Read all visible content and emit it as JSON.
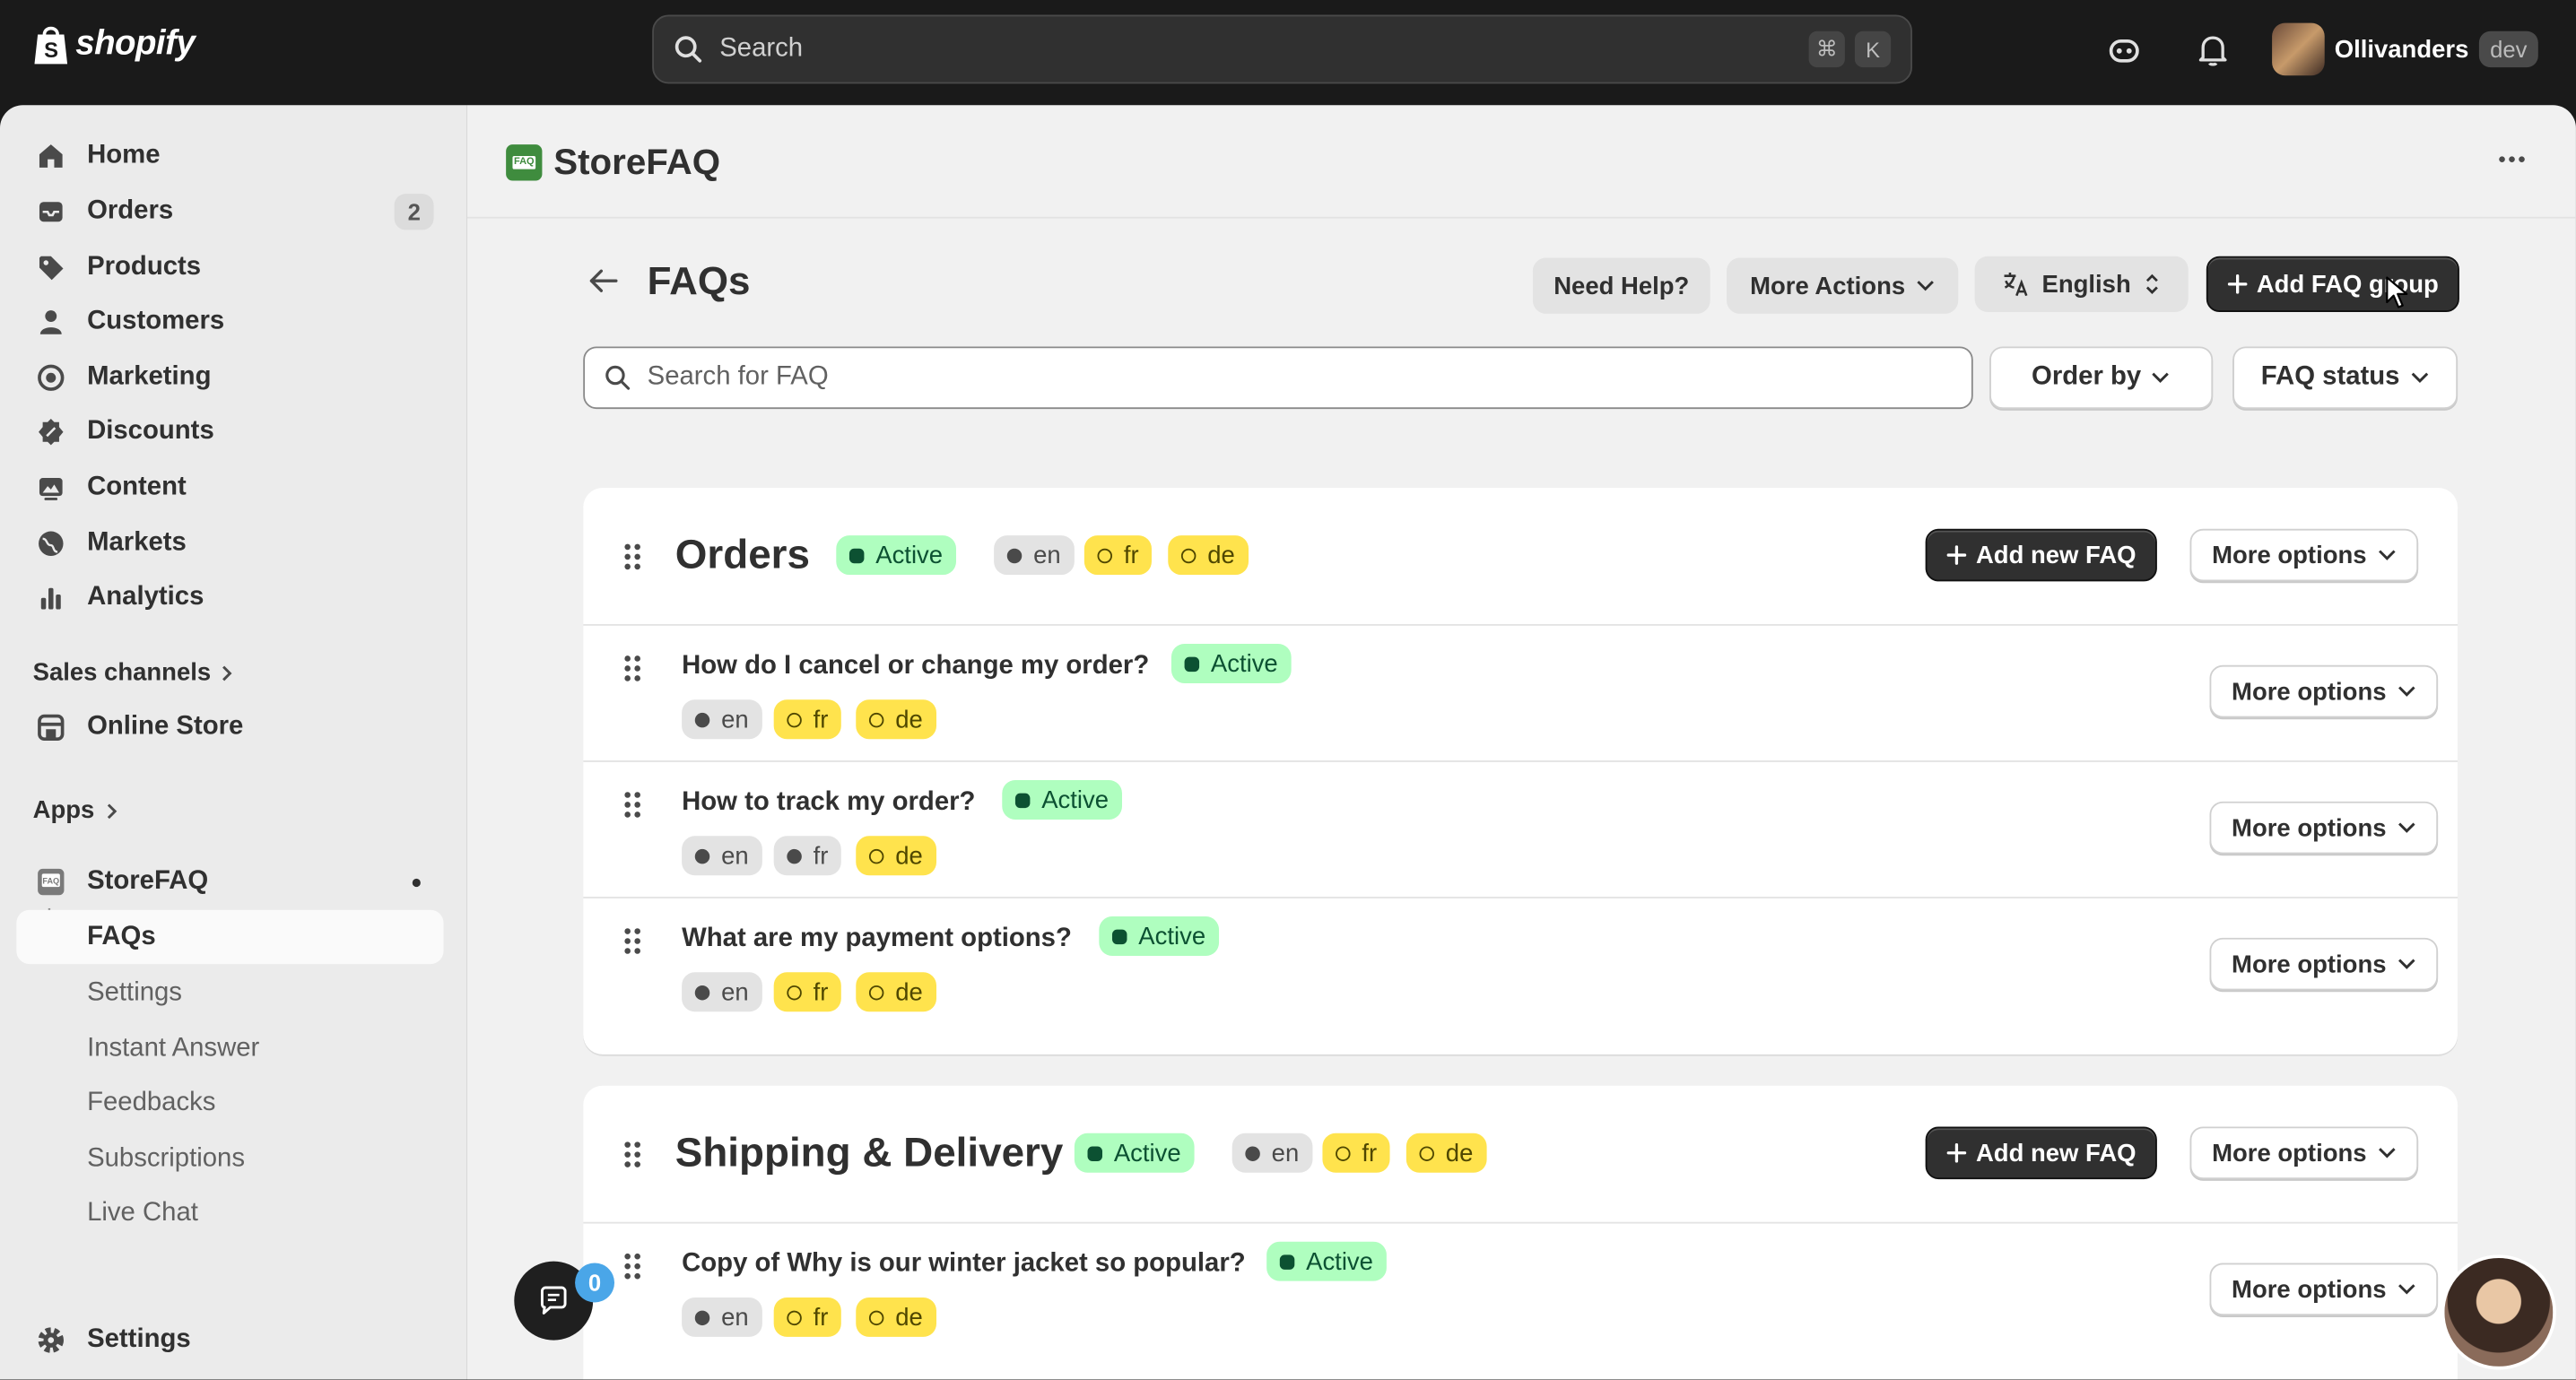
{
  "topbar": {
    "logo_text": "shopify",
    "search_placeholder": "Search",
    "shortcut_cmd": "⌘",
    "shortcut_key": "K",
    "store_name": "Ollivanders",
    "store_badge": "dev"
  },
  "sidebar": {
    "items": [
      {
        "label": "Home",
        "icon": "home-icon"
      },
      {
        "label": "Orders",
        "icon": "inbox-icon",
        "count": "2"
      },
      {
        "label": "Products",
        "icon": "tag-icon"
      },
      {
        "label": "Customers",
        "icon": "person-icon"
      },
      {
        "label": "Marketing",
        "icon": "target-icon"
      },
      {
        "label": "Discounts",
        "icon": "discount-icon"
      },
      {
        "label": "Content",
        "icon": "content-icon"
      },
      {
        "label": "Markets",
        "icon": "globe-icon"
      },
      {
        "label": "Analytics",
        "icon": "bar-chart-icon"
      }
    ],
    "sales_channels_label": "Sales channels",
    "online_store_label": "Online Store",
    "apps_label": "Apps",
    "app_name": "StoreFAQ",
    "app_subitems": [
      "FAQs",
      "Settings",
      "Instant Answer",
      "Feedbacks",
      "Subscriptions",
      "Live Chat"
    ],
    "settings_label": "Settings"
  },
  "app_header": {
    "logo_text": "FAQ",
    "title": "StoreFAQ"
  },
  "page": {
    "title": "FAQs",
    "need_help": "Need Help?",
    "more_actions": "More Actions",
    "language": "English",
    "add_group": "Add FAQ group",
    "search_placeholder": "Search for FAQ",
    "order_by": "Order by",
    "faq_status": "FAQ status"
  },
  "labels": {
    "active": "Active",
    "add_new_faq": "Add new FAQ",
    "more_options": "More options"
  },
  "groups": [
    {
      "title": "Orders",
      "status": "Active",
      "langs": [
        {
          "code": "en",
          "state": "on"
        },
        {
          "code": "fr",
          "state": "off"
        },
        {
          "code": "de",
          "state": "off"
        }
      ],
      "faqs": [
        {
          "question": "How do I cancel or change my order?",
          "status": "Active",
          "langs": [
            {
              "code": "en",
              "state": "on"
            },
            {
              "code": "fr",
              "state": "off"
            },
            {
              "code": "de",
              "state": "off"
            }
          ]
        },
        {
          "question": "How to track my order?",
          "status": "Active",
          "langs": [
            {
              "code": "en",
              "state": "on"
            },
            {
              "code": "fr",
              "state": "on"
            },
            {
              "code": "de",
              "state": "off"
            }
          ]
        },
        {
          "question": "What are my payment options?",
          "status": "Active",
          "langs": [
            {
              "code": "en",
              "state": "on"
            },
            {
              "code": "fr",
              "state": "off"
            },
            {
              "code": "de",
              "state": "off"
            }
          ]
        }
      ]
    },
    {
      "title": "Shipping & Delivery",
      "status": "Active",
      "langs": [
        {
          "code": "en",
          "state": "on"
        },
        {
          "code": "fr",
          "state": "off"
        },
        {
          "code": "de",
          "state": "off"
        }
      ],
      "faqs": [
        {
          "question": "Copy of Why is our winter jacket so popular?",
          "status": "Active",
          "langs": [
            {
              "code": "en",
              "state": "on"
            },
            {
              "code": "fr",
              "state": "off"
            },
            {
              "code": "de",
              "state": "off"
            }
          ]
        }
      ]
    }
  ],
  "chat": {
    "count": "0"
  },
  "colors": {
    "active_badge_bg": "#affebf",
    "active_badge_text": "#0c5132",
    "lang_missing_bg": "#ffe34d",
    "lang_present_bg": "#e3e3e3",
    "primary_button": "#303030"
  }
}
